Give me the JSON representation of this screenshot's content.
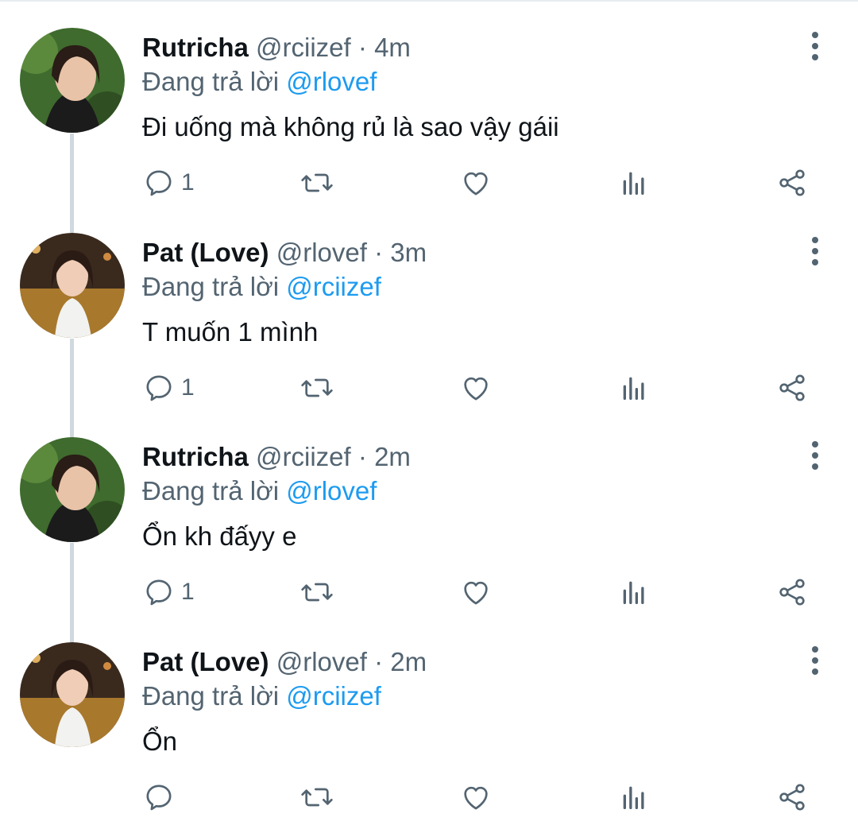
{
  "tweets": [
    {
      "name": "Rutricha",
      "handle": "@rciizef",
      "dot": "·",
      "time": "4m",
      "replying_prefix": "Đang trả lời ",
      "replying_to": "@rlovef",
      "text": "Đi uống mà không rủ là sao vậy gáii",
      "reply_count": "1",
      "avatar": "avatar-rutricha"
    },
    {
      "name": "Pat (Love)",
      "handle": "@rlovef",
      "dot": "·",
      "time": "3m",
      "replying_prefix": "Đang trả lời ",
      "replying_to": "@rciizef",
      "text": "T muốn 1 mình",
      "reply_count": "1",
      "avatar": "avatar-pat"
    },
    {
      "name": "Rutricha",
      "handle": "@rciizef",
      "dot": "·",
      "time": "2m",
      "replying_prefix": "Đang trả lời ",
      "replying_to": "@rlovef",
      "text": "Ổn kh đấyy e",
      "reply_count": "1",
      "avatar": "avatar-rutricha"
    },
    {
      "name": "Pat (Love)",
      "handle": "@rlovef",
      "dot": "·",
      "time": "2m",
      "replying_prefix": "Đang trả lời ",
      "replying_to": "@rciizef",
      "text": "Ổn",
      "reply_count": "",
      "avatar": "avatar-pat"
    }
  ],
  "icons": {
    "reply": "reply-icon",
    "retweet": "retweet-icon",
    "like": "heart-icon",
    "views": "views-icon",
    "share": "share-icon",
    "more": "more-vertical-icon"
  },
  "colors": {
    "text": "#0f1419",
    "secondary": "#536471",
    "mention": "#1d9bf0",
    "thread_line": "#cfd9de"
  }
}
